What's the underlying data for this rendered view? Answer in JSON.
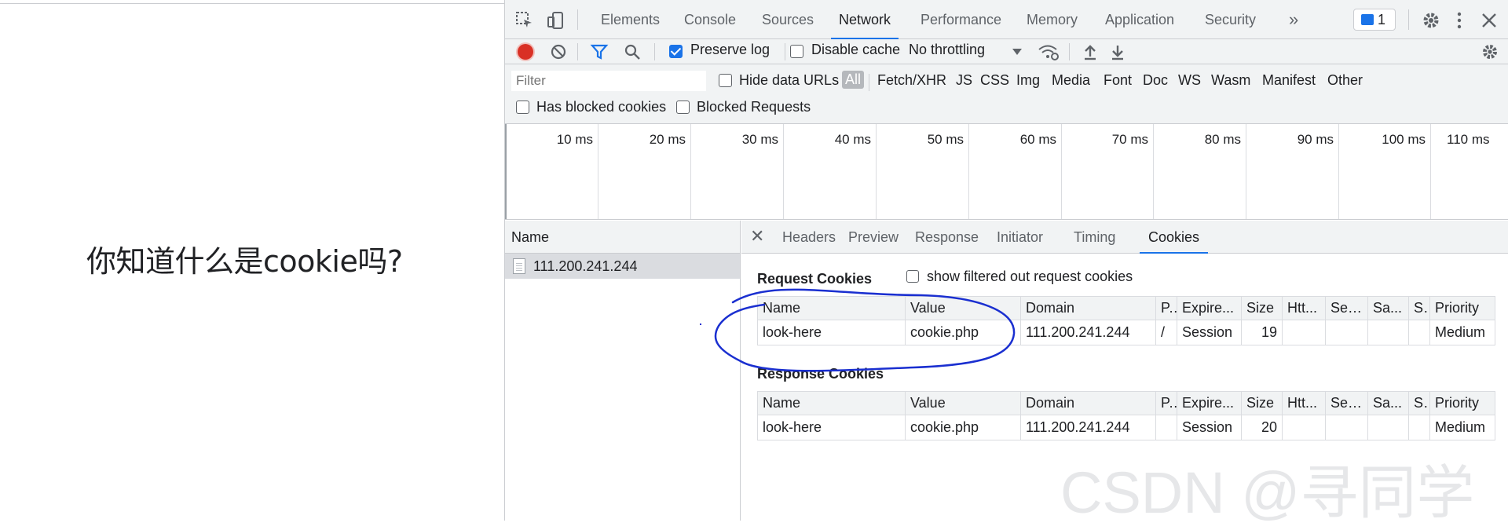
{
  "page": {
    "heading": "你知道什么是cookie吗?"
  },
  "devtools": {
    "tabs": [
      "Elements",
      "Console",
      "Sources",
      "Network",
      "Performance",
      "Memory",
      "Application",
      "Security"
    ],
    "active_tab": "Network",
    "more_tabs": "»",
    "issues_count": "1",
    "toolbar": {
      "preserve_log": "Preserve log",
      "preserve_log_checked": true,
      "disable_cache": "Disable cache",
      "disable_cache_checked": false,
      "throttling": "No throttling"
    },
    "filter": {
      "placeholder": "Filter",
      "hide_data_urls": "Hide data URLs",
      "types": [
        "All",
        "Fetch/XHR",
        "JS",
        "CSS",
        "Img",
        "Media",
        "Font",
        "Doc",
        "WS",
        "Wasm",
        "Manifest",
        "Other"
      ],
      "active_type": "All",
      "has_blocked_cookies": "Has blocked cookies",
      "blocked_requests": "Blocked Requests"
    },
    "timeline_ticks": [
      "10 ms",
      "20 ms",
      "30 ms",
      "40 ms",
      "50 ms",
      "60 ms",
      "70 ms",
      "80 ms",
      "90 ms",
      "100 ms",
      "110 ms"
    ],
    "requests": {
      "header": "Name",
      "items": [
        "111.200.241.244"
      ]
    },
    "detail_tabs": [
      "Headers",
      "Preview",
      "Response",
      "Initiator",
      "Timing",
      "Cookies"
    ],
    "active_detail_tab": "Cookies",
    "cookies": {
      "request_title": "Request Cookies",
      "show_filtered": "show filtered out request cookies",
      "response_title": "Response Cookies",
      "columns": [
        "Name",
        "Value",
        "Domain",
        "P.",
        "Expire...",
        "Size",
        "Htt...",
        "Sec...",
        "Sa...",
        "S.",
        "Priority"
      ],
      "request_rows": [
        [
          "look-here",
          "cookie.php",
          "111.200.241.244",
          "/",
          "Session",
          "19",
          "",
          "",
          "",
          "",
          "Medium"
        ]
      ],
      "response_rows": [
        [
          "look-here",
          "cookie.php",
          "111.200.241.244",
          "",
          "Session",
          "20",
          "",
          "",
          "",
          "",
          "Medium"
        ]
      ]
    }
  },
  "watermark": "CSDN @寻同学",
  "colors": {
    "accent": "#1a73e8",
    "record": "#d93025",
    "annotation": "#1a2fd0"
  }
}
